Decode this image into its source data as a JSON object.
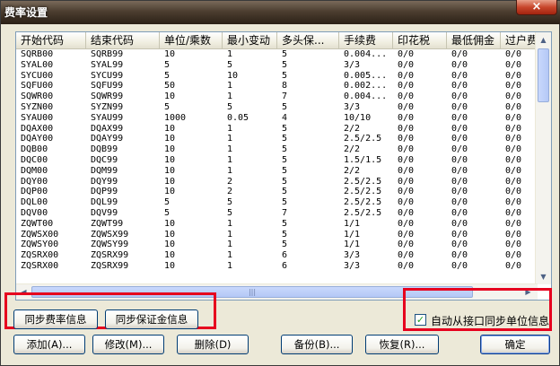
{
  "window": {
    "title": "费率设置",
    "close_glyph": "×"
  },
  "grid": {
    "columns": [
      "开始代码",
      "结束代码",
      "单位/乘数",
      "最小变动",
      "多头保...",
      "手续费",
      "印花税",
      "最低佣金",
      "过户费"
    ],
    "rows": [
      [
        "SQRB00",
        "SQRB99",
        "10",
        "1",
        "5",
        "0.004...",
        "0/0",
        "0/0",
        "0/0"
      ],
      [
        "SYAL00",
        "SYAL99",
        "5",
        "5",
        "5",
        "3/3",
        "0/0",
        "0/0",
        "0/0"
      ],
      [
        "SYCU00",
        "SYCU99",
        "5",
        "10",
        "5",
        "0.005...",
        "0/0",
        "0/0",
        "0/0"
      ],
      [
        "SQFU00",
        "SQFU99",
        "50",
        "1",
        "8",
        "0.002...",
        "0/0",
        "0/0",
        "0/0"
      ],
      [
        "SQWR00",
        "SQWR99",
        "10",
        "1",
        "7",
        "0.004...",
        "0/0",
        "0/0",
        "0/0"
      ],
      [
        "SYZN00",
        "SYZN99",
        "5",
        "5",
        "5",
        "3/3",
        "0/0",
        "0/0",
        "0/0"
      ],
      [
        "SYAU00",
        "SYAU99",
        "1000",
        "0.05",
        "4",
        "10/10",
        "0/0",
        "0/0",
        "0/0"
      ],
      [
        "DQAX00",
        "DQAX99",
        "10",
        "1",
        "5",
        "2/2",
        "0/0",
        "0/0",
        "0/0"
      ],
      [
        "DQAY00",
        "DQAY99",
        "10",
        "1",
        "5",
        "2.5/2.5",
        "0/0",
        "0/0",
        "0/0"
      ],
      [
        "DQB00",
        "DQB99",
        "10",
        "1",
        "5",
        "2/2",
        "0/0",
        "0/0",
        "0/0"
      ],
      [
        "DQC00",
        "DQC99",
        "10",
        "1",
        "5",
        "1.5/1.5",
        "0/0",
        "0/0",
        "0/0"
      ],
      [
        "DQM00",
        "DQM99",
        "10",
        "1",
        "5",
        "2/2",
        "0/0",
        "0/0",
        "0/0"
      ],
      [
        "DQY00",
        "DQY99",
        "10",
        "2",
        "5",
        "2.5/2.5",
        "0/0",
        "0/0",
        "0/0"
      ],
      [
        "DQP00",
        "DQP99",
        "10",
        "2",
        "5",
        "2.5/2.5",
        "0/0",
        "0/0",
        "0/0"
      ],
      [
        "DQL00",
        "DQL99",
        "5",
        "5",
        "5",
        "2.5/2.5",
        "0/0",
        "0/0",
        "0/0"
      ],
      [
        "DQV00",
        "DQV99",
        "5",
        "5",
        "7",
        "2.5/2.5",
        "0/0",
        "0/0",
        "0/0"
      ],
      [
        "ZQWT00",
        "ZQWT99",
        "10",
        "1",
        "5",
        "1/1",
        "0/0",
        "0/0",
        "0/0"
      ],
      [
        "ZQWSX00",
        "ZQWSX99",
        "10",
        "1",
        "5",
        "1/1",
        "0/0",
        "0/0",
        "0/0"
      ],
      [
        "ZQWSY00",
        "ZQWSY99",
        "10",
        "1",
        "5",
        "1/1",
        "0/0",
        "0/0",
        "0/0"
      ],
      [
        "ZQSRX00",
        "ZQSRX99",
        "10",
        "1",
        "6",
        "3/3",
        "0/0",
        "0/0",
        "0/0"
      ],
      [
        "ZQSRX00",
        "ZQSRX99",
        "10",
        "1",
        "6",
        "3/3",
        "0/0",
        "0/0",
        "0/0"
      ]
    ],
    "scroll_glyphs": {
      "up": "▲",
      "down": "▼",
      "left": "◀",
      "right": "▶",
      "grip": "|||"
    }
  },
  "sync": {
    "sync_fee_label": "同步费率信息",
    "sync_margin_label": "同步保证金信息",
    "auto_sync_label": "自动从接口同步单位信息",
    "auto_sync_checked": true,
    "check_glyph": "✓"
  },
  "buttons": {
    "add": "添加(A)...",
    "modify": "修改(M)...",
    "delete": "删除(D)",
    "backup": "备份(B)...",
    "restore": "恢复(R)...",
    "ok": "确定"
  },
  "colors": {
    "highlight_box": "#e6001e",
    "title_bar": "#4c3e30"
  }
}
